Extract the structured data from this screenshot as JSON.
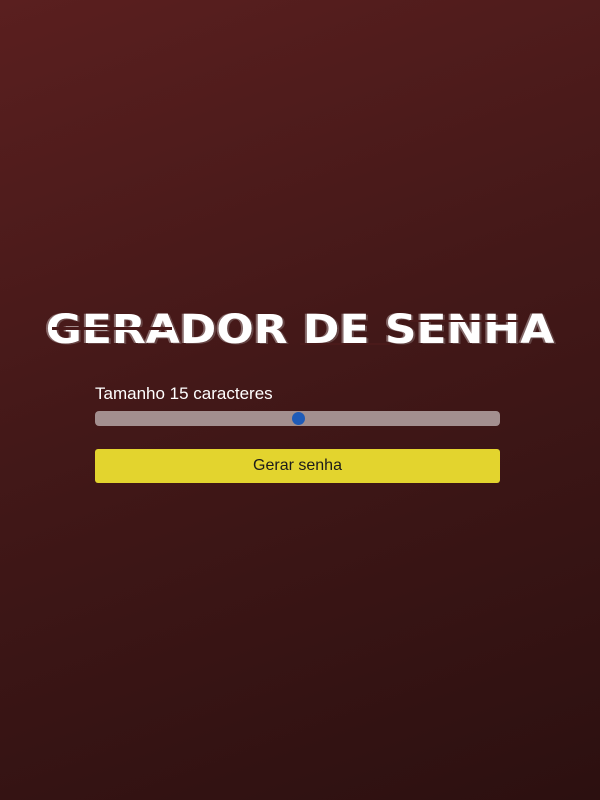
{
  "page": {
    "title": "GERADOR DE SENHA"
  },
  "length": {
    "label": "Tamanho 15 caracteres",
    "value": 15,
    "fraction": 0.5
  },
  "actions": {
    "generate_label": "Gerar senha"
  },
  "colors": {
    "background_top": "#5a1f1f",
    "background_bottom": "#2c1010",
    "slider_track": "#a38f8f",
    "slider_thumb": "#1f5bb8",
    "button": "#e3d42e"
  }
}
